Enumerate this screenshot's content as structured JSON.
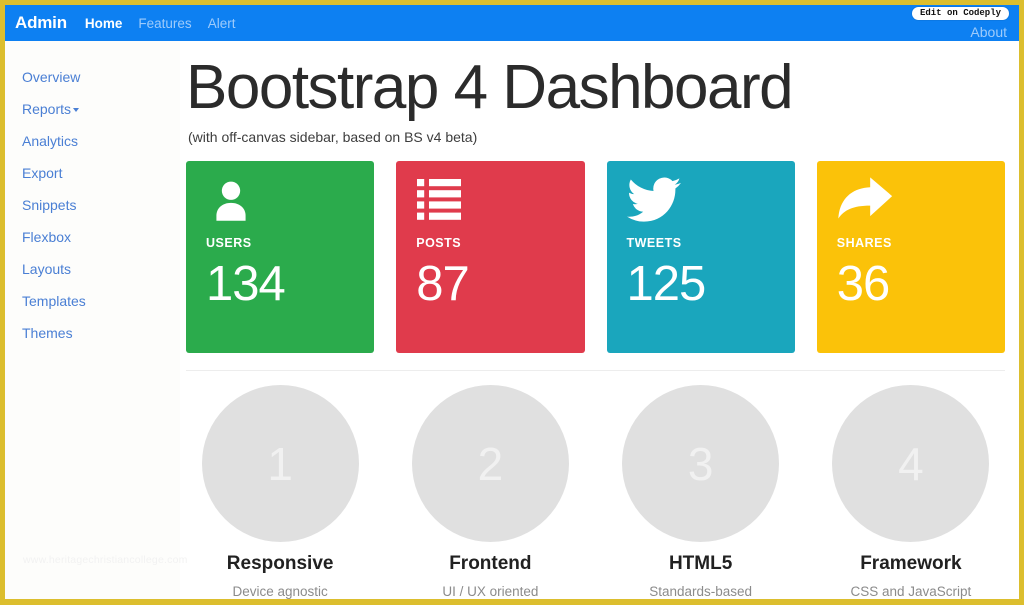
{
  "navbar": {
    "brand": "Admin",
    "links": [
      {
        "label": "Home",
        "state": "active"
      },
      {
        "label": "Features",
        "state": "muted"
      },
      {
        "label": "Alert",
        "state": "muted"
      }
    ],
    "about_label": "About",
    "codeply_badge": "Edit on Codeply",
    "background_color": "#0d80f2"
  },
  "sidebar": {
    "background_color": "#fdfdfb",
    "link_color": "#4a7fd4",
    "items": [
      {
        "label": "Overview",
        "has_caret": false
      },
      {
        "label": "Reports",
        "has_caret": true
      },
      {
        "label": "Analytics",
        "has_caret": false
      },
      {
        "label": "Export",
        "has_caret": false
      },
      {
        "label": "Snippets",
        "has_caret": false
      },
      {
        "label": "Flexbox",
        "has_caret": false
      },
      {
        "label": "Layouts",
        "has_caret": false
      },
      {
        "label": "Templates",
        "has_caret": false
      },
      {
        "label": "Themes",
        "has_caret": false
      }
    ],
    "watermark": "www.heritagechristiancollege.com"
  },
  "main": {
    "title": "Bootstrap 4 Dashboard",
    "subtitle": "(with off-canvas sidebar, based on BS v4 beta)",
    "stat_cards": [
      {
        "label": "USERS",
        "value": "134",
        "icon": "user-icon",
        "color": "#2bab4c"
      },
      {
        "label": "POSTS",
        "value": "87",
        "icon": "list-icon",
        "color": "#e03b4c"
      },
      {
        "label": "TWEETS",
        "value": "125",
        "icon": "twitter-icon",
        "color": "#1aa6bd"
      },
      {
        "label": "SHARES",
        "value": "36",
        "icon": "share-icon",
        "color": "#fbc209"
      }
    ],
    "features": [
      {
        "number": "1",
        "title": "Responsive",
        "description": "Device agnostic"
      },
      {
        "number": "2",
        "title": "Frontend",
        "description": "UI / UX oriented"
      },
      {
        "number": "3",
        "title": "HTML5",
        "description": "Standards-based"
      },
      {
        "number": "4",
        "title": "Framework",
        "description": "CSS and JavaScript"
      }
    ]
  },
  "frame": {
    "border_color": "#dcbe2e"
  }
}
